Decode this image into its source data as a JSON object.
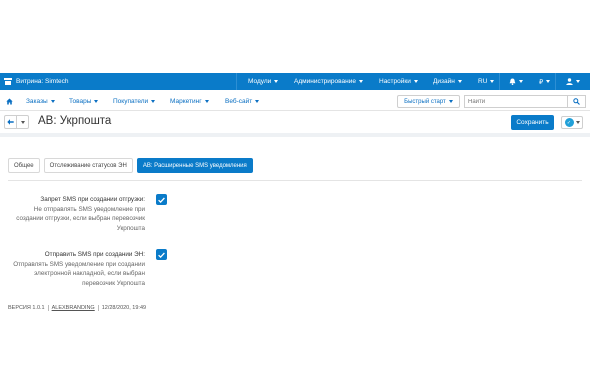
{
  "topbar": {
    "storefront": "Витрина: Simtech",
    "modules": "Модули",
    "administration": "Администрирование",
    "settings": "Настройки",
    "design": "Дизайн",
    "language": "RU",
    "currency": "₽"
  },
  "nav": {
    "orders": "Заказы",
    "products": "Товары",
    "customers": "Покупатели",
    "marketing": "Маркетинг",
    "website": "Веб-сайт",
    "quick_start": "Быстрый старт",
    "search_placeholder": "Найти"
  },
  "title": {
    "text": "AB: Укрпошта",
    "save": "Сохранить"
  },
  "tabs": [
    {
      "label": "Общее"
    },
    {
      "label": "Отслеживание статусов ЭН"
    },
    {
      "label": "AB: Расширенные SMS уведомления",
      "active": true
    }
  ],
  "settings": [
    {
      "label": "Запрет SMS при создании отгрузки:",
      "desc1": "Не отправлять SMS уведомление при",
      "desc2": "создании отгрузки, если выбран перевозчик",
      "desc3": "Укрпошта",
      "checked": true
    },
    {
      "label": "Отправить SMS при создании ЭН:",
      "desc1": "Отправлять SMS уведомление при создании",
      "desc2": "электронной накладной, если выбран",
      "desc3": "перевозчик Укрпошта",
      "checked": true
    }
  ],
  "footer": {
    "version": "ВЕРСИЯ 1.0.1",
    "vendor": "ALEXBRANDING",
    "date": "12/28/2020, 19:49"
  },
  "colors": {
    "accent": "#0a7bc9"
  }
}
